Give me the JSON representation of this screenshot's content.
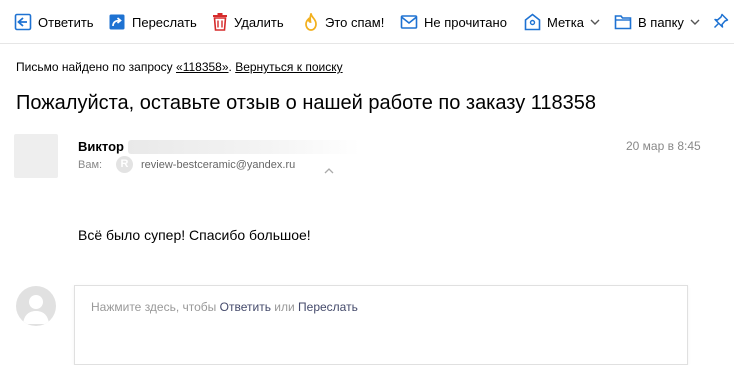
{
  "toolbar": {
    "reply_label": "Ответить",
    "forward_label": "Переслать",
    "delete_label": "Удалить",
    "spam_label": "Это спам!",
    "unread_label": "Не прочитано",
    "label_label": "Метка",
    "folder_label": "В папку",
    "icon_color": "#1e72d2",
    "delete_color": "#d62b2b",
    "spam_color": "#f2b01e"
  },
  "search_notice": {
    "prefix": "Письмо найдено по запросу ",
    "query": "«118358»",
    "separator": ". ",
    "back_link": "Вернуться к поиску"
  },
  "message": {
    "subject": "Пожалуйста, оставьте отзыв о нашей работе по заказу 118358",
    "sender_name": "Виктор",
    "to_label": "Вам:",
    "to_avatar_letter": "R",
    "to_email": "review-bestceramic@yandex.ru",
    "date": "20 мар в 8:45",
    "body": "Всё было супер! Спасибо большое!"
  },
  "reply": {
    "hint_prefix": "Нажмите здесь, чтобы ",
    "reply_link": "Ответить",
    "hint_middle": " или ",
    "forward_link": "Переслать"
  }
}
